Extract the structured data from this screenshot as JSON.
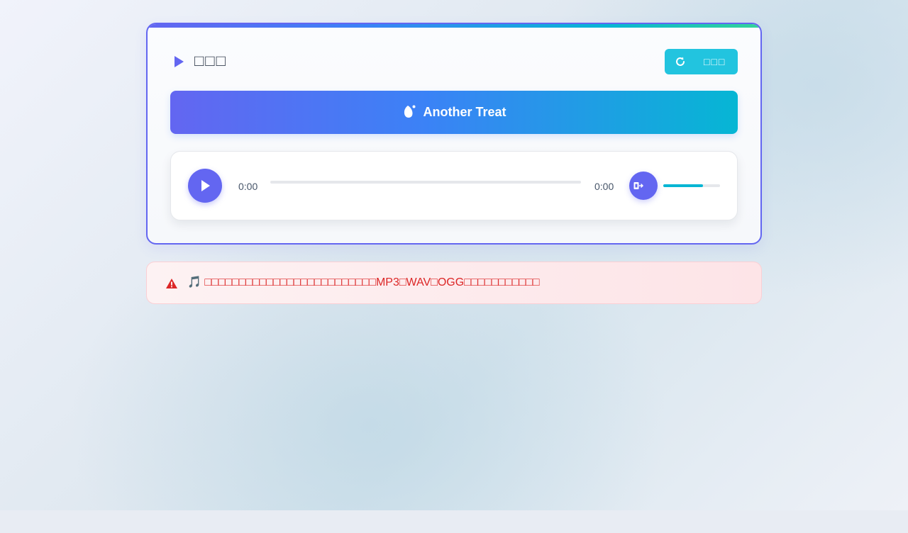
{
  "player": {
    "title": "□□□",
    "refresh_label": "□□□",
    "treat_label": "Another Treat",
    "current_time": "0:00",
    "duration": "0:00",
    "progress": 0,
    "volume": 0.7
  },
  "error": {
    "message": "🎵 □□□□□□□□□□□□□□□□□□□□□□□□□MP3□WAV□OGG□□□□□□□□□□□"
  },
  "colors": {
    "accent": "#6366f1",
    "secondary": "#06b6d4",
    "error": "#dc2626"
  },
  "icons": {
    "header": "play-triangle-icon",
    "refresh": "refresh-icon",
    "treat": "treat-icon",
    "play": "play-icon",
    "volume": "volume-icon",
    "warning": "warning-icon"
  }
}
